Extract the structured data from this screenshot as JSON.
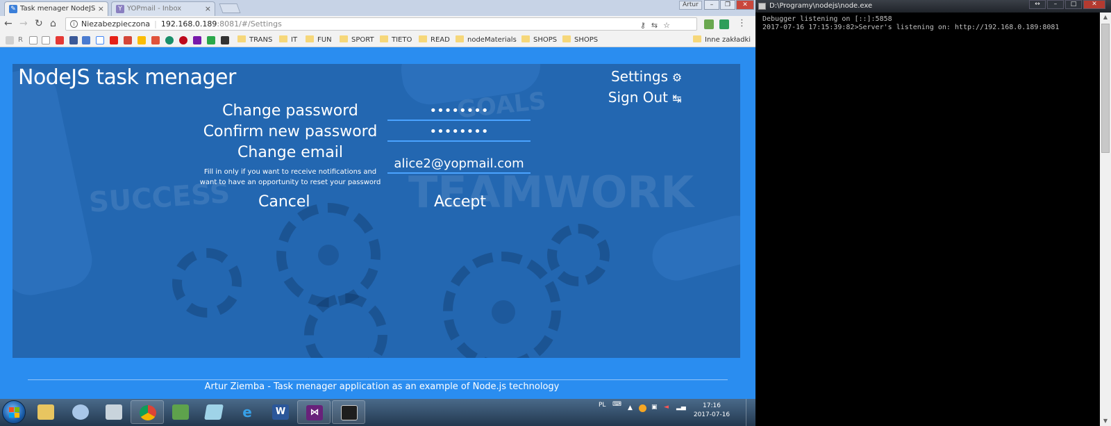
{
  "browser": {
    "tabs": [
      {
        "label": "Task menager NodeJS",
        "active": true
      },
      {
        "label": "YOPmail - Inbox",
        "active": false
      }
    ],
    "window_user": "Artur",
    "address": {
      "security": "Niezabezpieczona",
      "host": "192.168.0.189",
      "path": ":8081/#/Settings"
    },
    "bookmark_letter": "R",
    "bookmarks": [
      "TRANS",
      "IT",
      "FUN",
      "SPORT",
      "TIETO",
      "READ",
      "nodeMaterials",
      "SHOPS",
      "SHOPS"
    ],
    "other_bookmarks": "Inne zakładki"
  },
  "app": {
    "title": "NodeJS task menager",
    "nav": {
      "settings": "Settings",
      "settings_icon": "⚙",
      "sign_out": "Sign Out",
      "sign_out_icon": "↹"
    },
    "background_words": [
      "GOALS",
      "SUCCESS",
      "TEAMWORK"
    ],
    "form": {
      "change_password_label": "Change password",
      "change_password_value": "••••••••",
      "confirm_password_label": "Confirm new password",
      "confirm_password_value": "••••••••",
      "change_email_label": "Change email",
      "email_hint_line1": "Fill in only if you want to receive notifications and",
      "email_hint_line2": "want to have an opportunity to reset your password",
      "email_value": "alice2@yopmail.com",
      "cancel": "Cancel",
      "accept": "Accept"
    },
    "footer": "Artur Ziemba - Task menager application as an example of Node.js technology"
  },
  "console": {
    "title": "D:\\Programy\\nodejs\\node.exe",
    "line1": "Debugger listening on [::]:5858",
    "line2": "2017-07-16 17:15:39:82>Server's listening on: http://192.168.0.189:8081"
  },
  "taskbar": {
    "language": "PL",
    "time": "17:16",
    "date": "2017-07-16"
  }
}
